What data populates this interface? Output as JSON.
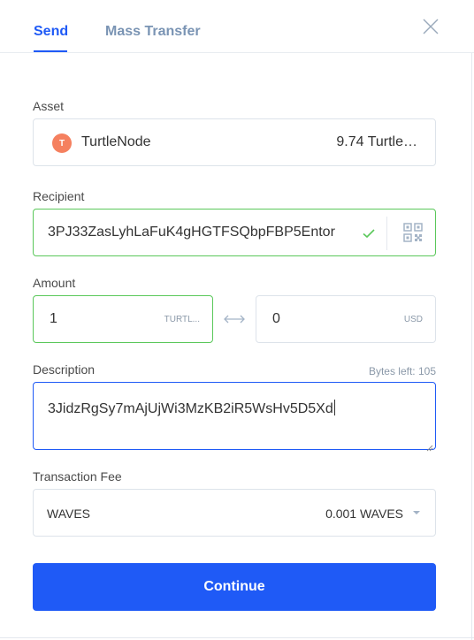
{
  "tabs": [
    {
      "label": "Send",
      "active": true
    },
    {
      "label": "Mass Transfer",
      "active": false
    }
  ],
  "close_icon": "close-icon",
  "asset": {
    "label": "Asset",
    "icon_letter": "T",
    "name": "TurtleNode",
    "balance": "9.74 Turtle…",
    "icon_color": "#f5805f"
  },
  "recipient": {
    "label": "Recipient",
    "value": "3PJ33ZasLyhLaFuK4gHGTFSQbpFBP5Entor",
    "valid": true
  },
  "amount": {
    "label": "Amount",
    "value": "1",
    "unit": "TURTL...",
    "usd_value": "0",
    "usd_unit": "USD"
  },
  "description": {
    "label": "Description",
    "bytes_left": "Bytes left: 105",
    "value": "3JidzRgSy7mAjUjWi3MzKB2iR5WsHv5D5Xd"
  },
  "fee": {
    "label": "Transaction Fee",
    "asset": "WAVES",
    "amount": "0.001 WAVES"
  },
  "continue_label": "Continue",
  "colors": {
    "accent": "#1f5af6",
    "valid_border": "#5ac85a",
    "inactive_tab": "#7a94b4"
  }
}
